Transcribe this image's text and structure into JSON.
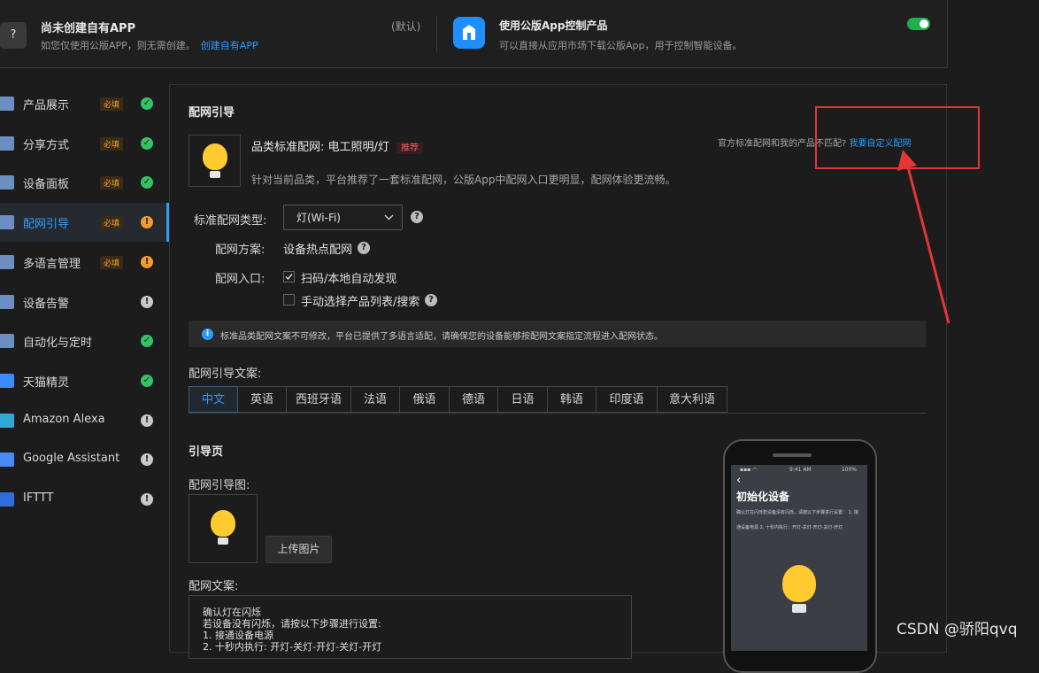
{
  "top": {
    "left_icon": "?",
    "title": "尚未创建自有APP",
    "desc": "如您仅使用公版APP，则无需创建。",
    "create_link": "创建自有APP",
    "default_label": "(默认)",
    "right_title": "使用公版App控制产品",
    "right_desc": "可以直接从应用市场下载公版App，用于控制智能设备。",
    "toggle_on": true
  },
  "sidebar": {
    "items": [
      {
        "label": "产品展示",
        "required": "必填",
        "status": "ok",
        "icon": "product-icon"
      },
      {
        "label": "分享方式",
        "required": "必填",
        "status": "ok",
        "icon": "share-icon"
      },
      {
        "label": "设备面板",
        "required": "必填",
        "status": "ok",
        "icon": "panel-icon"
      },
      {
        "label": "配网引导",
        "required": "必填",
        "status": "warn",
        "icon": "network-icon"
      },
      {
        "label": "多语言管理",
        "required": "必填",
        "status": "warn",
        "icon": "language-icon"
      },
      {
        "label": "设备告警",
        "required": "",
        "status": "info",
        "icon": "alarm-icon"
      },
      {
        "label": "自动化与定时",
        "required": "",
        "status": "ok",
        "icon": "automation-icon"
      },
      {
        "label": "天猫精灵",
        "required": "",
        "status": "ok",
        "icon": "tmall-genie-icon"
      },
      {
        "label": "Amazon Alexa",
        "required": "",
        "status": "info",
        "icon": "alexa-icon"
      },
      {
        "label": "Google Assistant",
        "required": "",
        "status": "info",
        "icon": "google-assistant-icon"
      },
      {
        "label": "IFTTT",
        "required": "",
        "status": "info",
        "icon": "ifttt-icon"
      }
    ],
    "status_glyphs": {
      "ok": "✓",
      "warn": "!",
      "info": "!"
    }
  },
  "main": {
    "section_title": "配网引导",
    "category_title": "品类标准配网: 电工照明/灯",
    "recommend_tag": "推荐",
    "category_desc": "针对当前品类，平台推荐了一套标准配网，公版App中配网入口更明显，配网体验更流畅。",
    "mismatch_text": "官方标准配网和我的产品不匹配?",
    "custom_link": "我要自定义配网",
    "type_label": "标准配网类型:",
    "type_value": "灯(Wi-Fi)",
    "scheme_label": "配网方案:",
    "scheme_value": "设备热点配网",
    "entry_label": "配网入口:",
    "entry_options": [
      {
        "label": "扫码/本地自动发现",
        "checked": true
      },
      {
        "label": "手动选择产品列表/搜索",
        "checked": false
      }
    ],
    "notice": "标准品类配网文案不可修改，平台已提供了多语言适配，请确保您的设备能够按配网文案指定流程进入配网状态。",
    "copy_label": "配网引导文案:",
    "tabs": [
      "中文",
      "英语",
      "西班牙语",
      "法语",
      "俄语",
      "德语",
      "日语",
      "韩语",
      "印度语",
      "意大利语"
    ],
    "active_tab": 0,
    "guide_title": "引导页",
    "image_label": "配网引导图:",
    "upload_button": "上传图片",
    "text_label": "配网文案:",
    "text_lines": [
      "确认灯在闪烁",
      "若设备没有闪烁，请按以下步骤进行设置:",
      "1. 接通设备电源",
      "2. 十秒内执行: 开灯-关灯-开灯-关灯-开灯"
    ]
  },
  "phone": {
    "time": "9:41 AM",
    "battery": "100%",
    "back": "‹",
    "title": "初始化设备",
    "line1": "确认灯在闪烁若设备没有闪烁，请按以下步骤进行设置： 1. 接",
    "line2": "通设备电源 2. 十秒内执行：开灯-关灯-开灯-关灯-开灯"
  },
  "watermark": "CSDN @骄阳qvq",
  "colors": {
    "accent": "#2f9bff",
    "ok": "#35c267",
    "warn": "#f29a2e",
    "annotation": "#e53535",
    "bulb": "#ffcb2f"
  }
}
